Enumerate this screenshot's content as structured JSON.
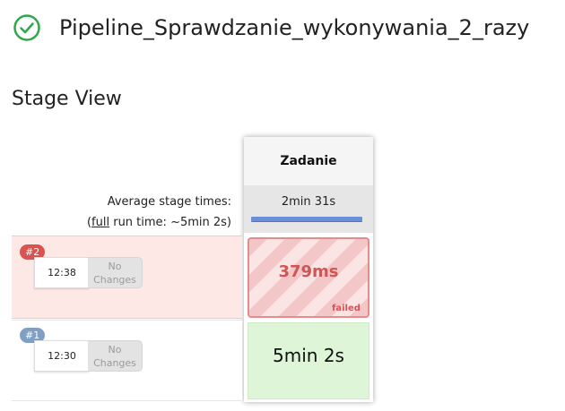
{
  "job": {
    "title": "Pipeline_Sprawdzanie_wykonywania_2_razy",
    "status_icon": "check-circle-icon",
    "status_color": "#2ea84a"
  },
  "stage_view": {
    "heading": "Stage View",
    "avg_label": "Average stage times:",
    "fullrun_prefix": "(",
    "fullrun_link": "full",
    "fullrun_suffix": " run time: ~5min 2s)",
    "stage": {
      "name": "Zadanie",
      "avg_time": "2min 31s"
    },
    "builds": [
      {
        "number": "#2",
        "time": "12:38",
        "changes": "No Changes",
        "stage_time": "379ms",
        "stage_status": "failed",
        "color": "#d9534f"
      },
      {
        "number": "#1",
        "time": "12:30",
        "changes": "No Changes",
        "stage_time": "5min 2s",
        "color": "#7fa0c4"
      }
    ]
  }
}
